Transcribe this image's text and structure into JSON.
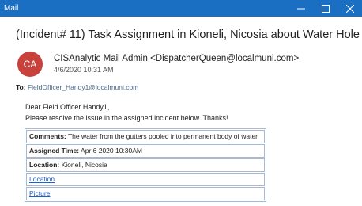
{
  "window": {
    "title": "Mail",
    "controls": {
      "minimize_icon": "minimize-icon",
      "maximize_icon": "maximize-icon",
      "close_icon": "close-icon"
    },
    "accent_color": "#1b6fc2"
  },
  "email": {
    "subject": "(Incident# 11) Task Assignment in Kioneli, Nicosia about Water Hole",
    "avatar_initials": "CA",
    "avatar_color": "#c9413b",
    "sender": "CISAnalytic Mail Admin <DispatcherQueen@localmuni.com>",
    "date": "4/6/2020 10:31 AM",
    "to_label": "To:",
    "to_address": "FieldOfficer_Handy1@localmuni.com",
    "greeting": "Dear Field Officer Handy1,",
    "body": "Please resolve the issue in the assigned incident below. Thanks!",
    "details": {
      "comments_label": "Comments:",
      "comments_value": "The water from the gutters pooled into permanent body of water.",
      "assigned_label": "Assigned Time:",
      "assigned_value": "Apr 6 2020 10:30AM",
      "location_label": "Location:",
      "location_value": "Kioneli, Nicosia",
      "location_link": "Location",
      "picture_link": "Picture"
    }
  }
}
